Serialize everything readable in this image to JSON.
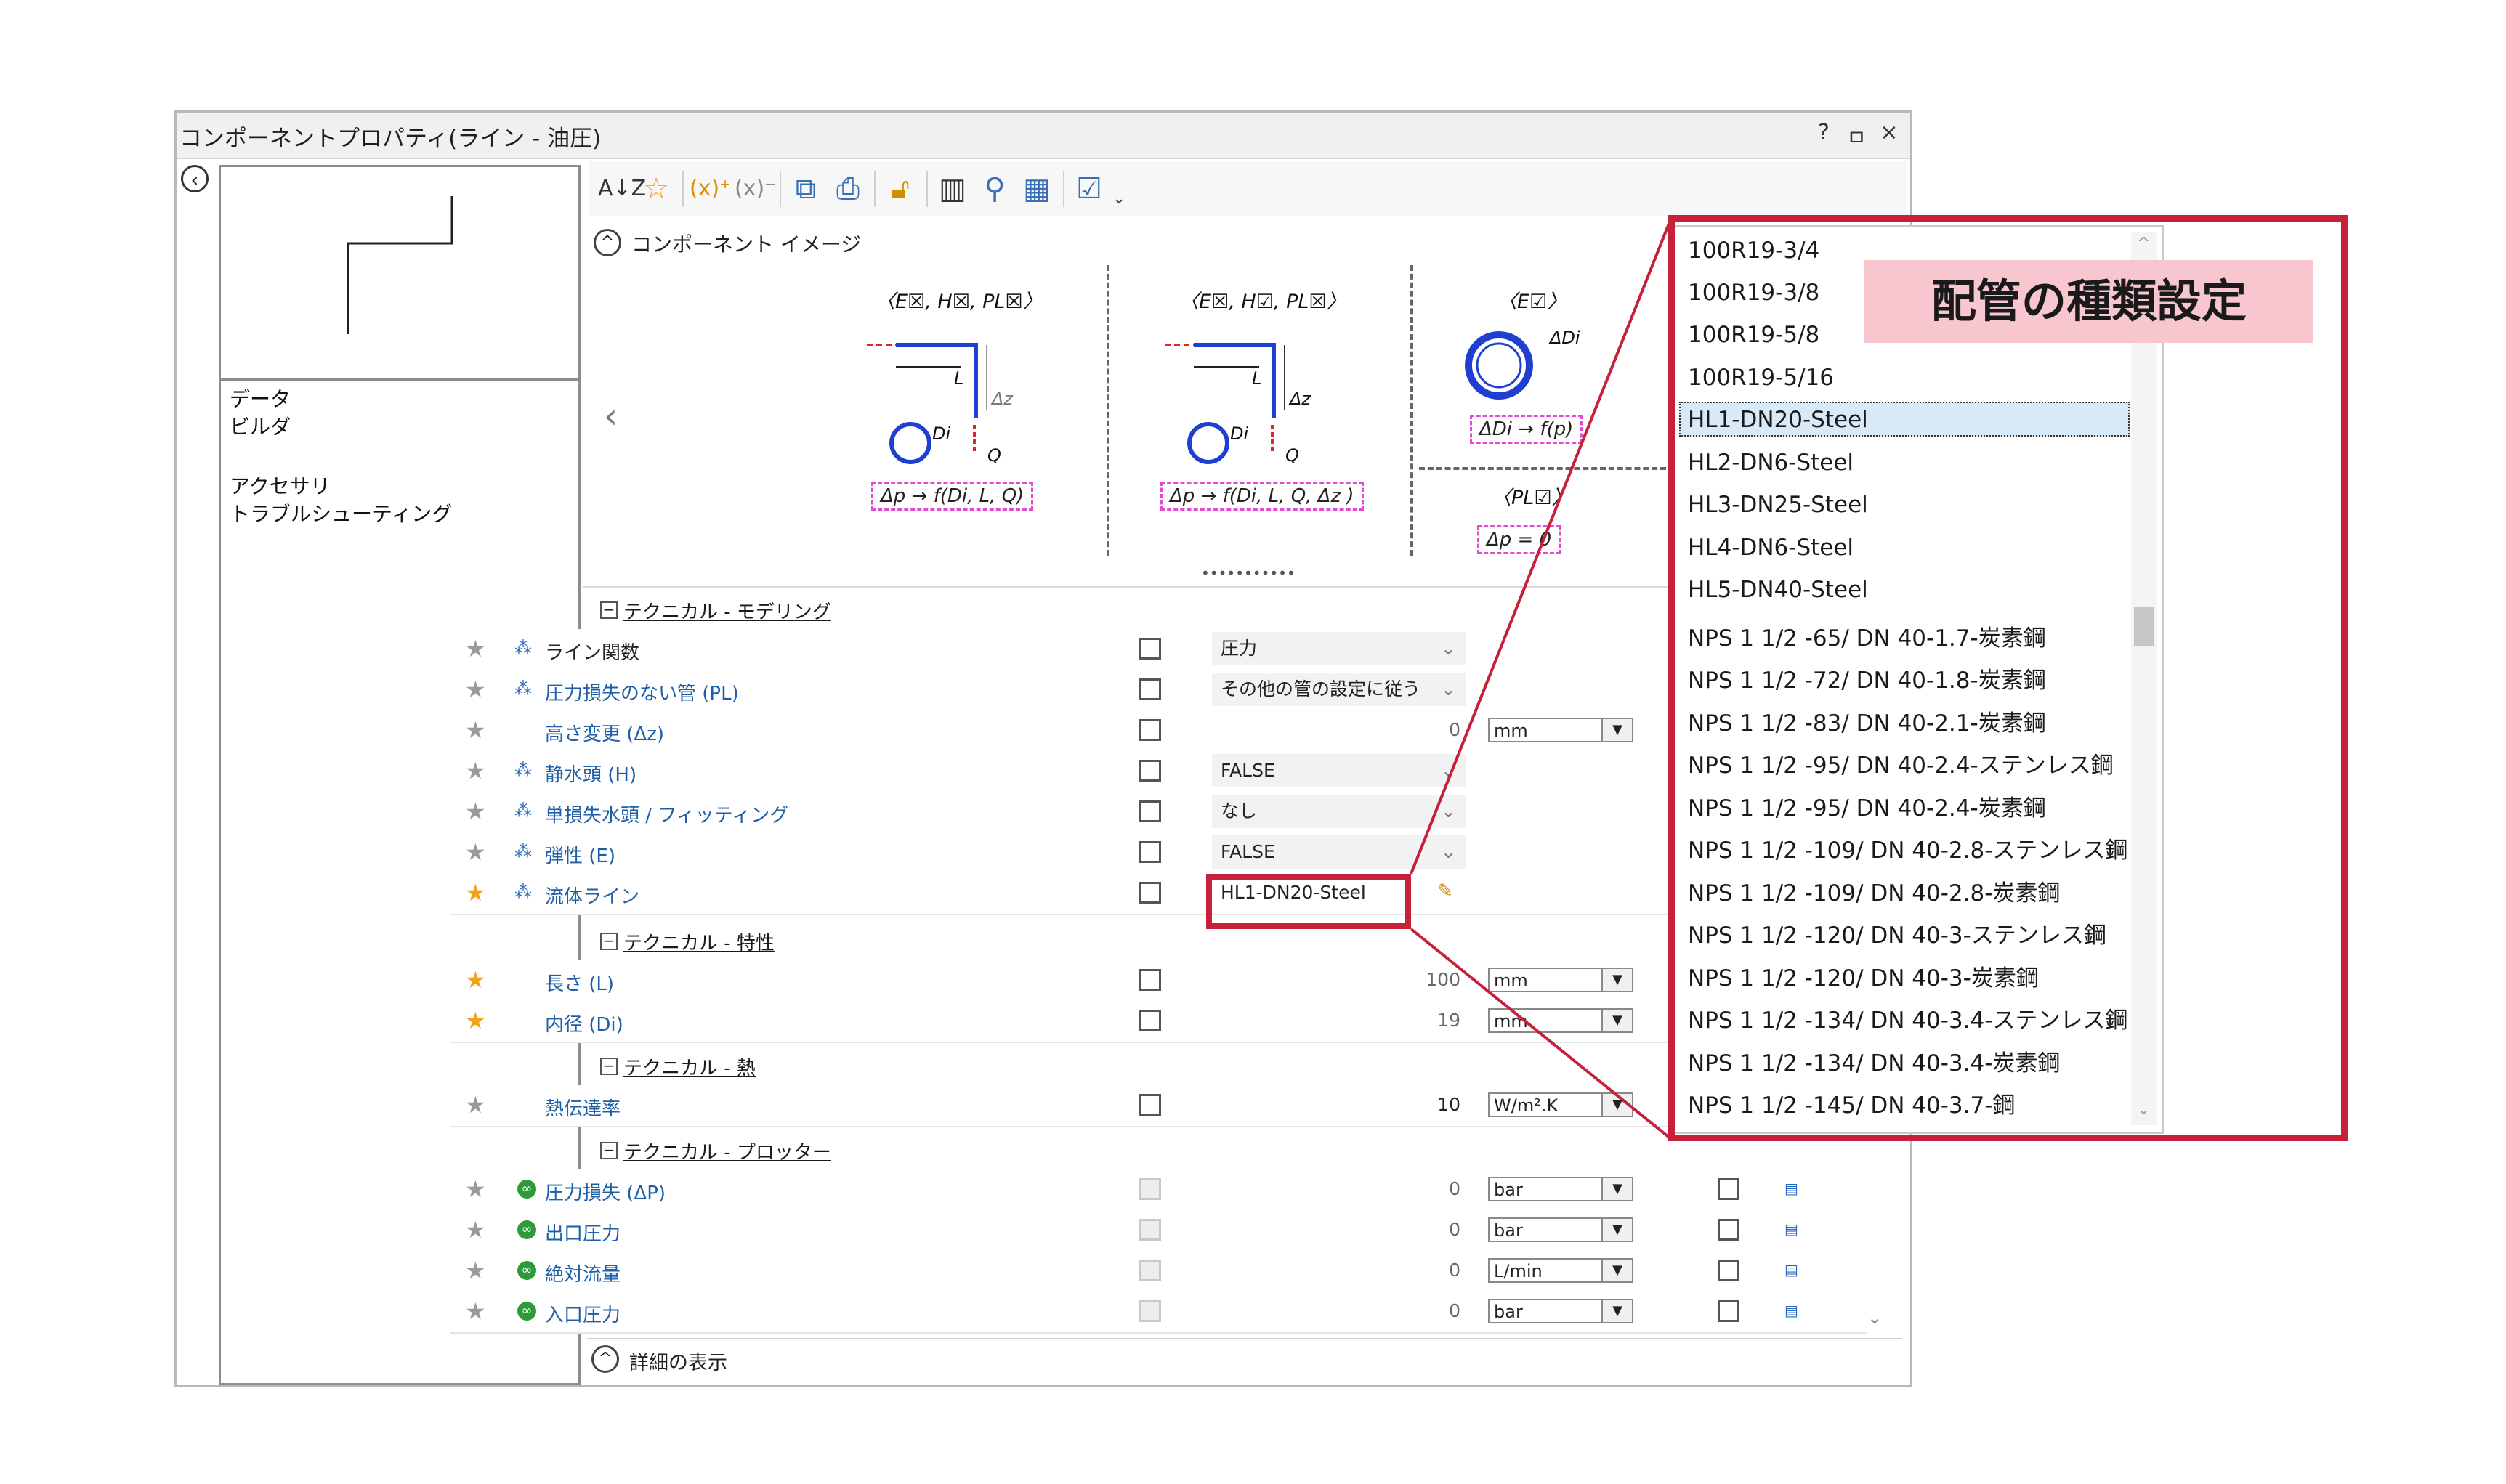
{
  "window": {
    "title": "コンポーネントプロパティ(ライン - 油圧)",
    "controls": [
      "?",
      "ㅁ",
      "×"
    ]
  },
  "left_nav": {
    "items": [
      "データ",
      "ビルダ",
      "アクセサリ",
      "トラブルシューティング"
    ]
  },
  "toolbar": {
    "overflow": "⌄"
  },
  "image_section": {
    "label": "コンポーネント イメージ",
    "dots": "•••••••••••",
    "diagrams": [
      {
        "header": "〈E☒, H☒, PL☒〉",
        "formula": "Δp → f(Di, L, Q)",
        "labels": [
          "L",
          "Δz",
          "Di",
          "Q"
        ]
      },
      {
        "header": "〈E☒, H☑, PL☒〉",
        "formula": "Δp → f(Di, L, Q, Δz )",
        "labels": [
          "L",
          "Δz",
          "Di",
          "Q"
        ]
      },
      {
        "header": "〈E☑〉",
        "formula": "ΔDi → f(p)",
        "labels": [
          "ΔDi"
        ]
      },
      {
        "header": "〈PL☑〉",
        "formula": "Δp = 0"
      }
    ]
  },
  "groups": [
    {
      "title": "テクニカル - モデリング",
      "rows": [
        {
          "label": "ライン関数",
          "value": "圧力",
          "starred": false,
          "icon": "tree-icon"
        },
        {
          "label": "圧力損失のない管 (PL)",
          "value": "その他の管の設定に従う",
          "starred": false,
          "icon": "tree-icon"
        },
        {
          "label": "高さ変更 (Δz)",
          "number": "0",
          "unit": "mm",
          "starred": false
        },
        {
          "label": "静水頭 (H)",
          "value": "FALSE",
          "starred": false,
          "icon": "tree-icon"
        },
        {
          "label": "単損失水頭 / フィッティング",
          "value": "なし",
          "starred": false,
          "icon": "tree-icon"
        },
        {
          "label": "弾性 (E)",
          "value": "FALSE",
          "starred": false,
          "icon": "tree-icon"
        },
        {
          "label": "流体ライン",
          "value": "HL1-DN20-Steel",
          "starred": true,
          "icon": "tree-icon"
        }
      ]
    },
    {
      "title": "テクニカル - 特性",
      "rows": [
        {
          "label": "長さ (L)",
          "number": "100",
          "unit": "mm",
          "starred": true
        },
        {
          "label": "内径 (Di)",
          "number": "19",
          "unit": "mm",
          "starred": true
        }
      ]
    },
    {
      "title": "テクニカル - 熱",
      "rows": [
        {
          "label": "熱伝達率",
          "number": "10",
          "unit": "W/m².K",
          "starred": false
        }
      ]
    },
    {
      "title": "テクニカル - プロッター",
      "rows": [
        {
          "label": "圧力損失 (ΔP)",
          "number": "0",
          "unit": "bar",
          "starred": false
        },
        {
          "label": "出口圧力",
          "number": "0",
          "unit": "bar",
          "starred": false
        },
        {
          "label": "絶対流量",
          "number": "0",
          "unit": "L/min",
          "starred": false
        },
        {
          "label": "入口圧力",
          "number": "0",
          "unit": "bar",
          "starred": false
        }
      ]
    }
  ],
  "footer": {
    "label": "詳細の表示"
  },
  "dropdown": {
    "options": [
      "100R19-3/4",
      "100R19-3/8",
      "100R19-5/8",
      "100R19-5/16",
      "HL1-DN20-Steel",
      "HL2-DN6-Steel",
      "HL3-DN25-Steel",
      "HL4-DN6-Steel",
      "HL5-DN40-Steel",
      "NPS 1 1/2 -65/ DN 40-1.7-炭素鋼",
      "NPS 1 1/2 -72/ DN 40-1.8-炭素鋼",
      "NPS 1 1/2 -83/ DN 40-2.1-炭素鋼",
      "NPS 1 1/2 -95/ DN 40-2.4-ステンレス鋼",
      "NPS 1 1/2 -95/ DN 40-2.4-炭素鋼",
      "NPS 1 1/2 -109/ DN 40-2.8-ステンレス鋼",
      "NPS 1 1/2 -109/ DN 40-2.8-炭素鋼",
      "NPS 1 1/2 -120/ DN 40-3-ステンレス鋼",
      "NPS 1 1/2 -120/ DN 40-3-炭素鋼",
      "NPS 1 1/2 -134/ DN 40-3.4-ステンレス鋼",
      "NPS 1 1/2 -134/ DN 40-3.4-炭素鋼",
      "NPS 1 1/2 -145/ DN 40-3.7-鋼"
    ],
    "selected": "HL1-DN20-Steel"
  },
  "callout": {
    "text": "配管の種類設定"
  },
  "colors": {
    "annotation_red": "#c6203a",
    "callout_pink": "#f7c6cf",
    "label_blue": "#1e5fa8",
    "magenta_box": "#e24ad6"
  }
}
